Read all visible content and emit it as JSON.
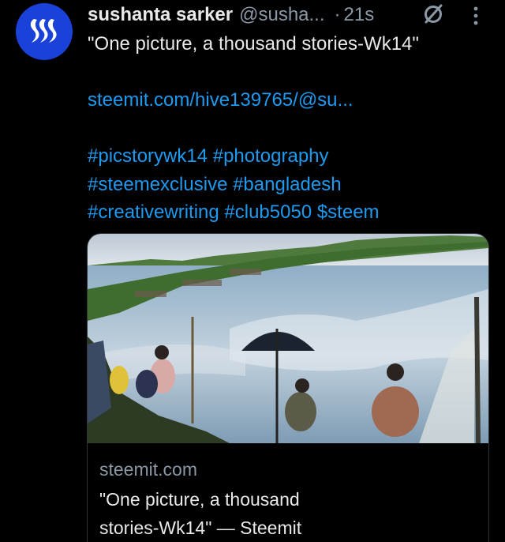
{
  "author": {
    "name": "sushanta sarker",
    "handle": "@susha...",
    "time_separator": "·",
    "time": "21s"
  },
  "icons": {
    "avatar": "steemit-logo-icon",
    "edit_status": "no-edit-icon",
    "menu": "more-vertical-icon"
  },
  "tweet": {
    "line1": "\"One picture, a thousand stories-Wk14\"",
    "link": "steemit.com/hive139765/@su...",
    "hashtags_line1": "#picstorywk14 #photography",
    "hashtags_line2": "#steemexclusive #bangladesh",
    "hashtags_line3": "#creativewriting #club5050 $steem"
  },
  "card": {
    "domain": "steemit.com",
    "title_line1": "\"One picture, a thousand",
    "title_line2": "stories-Wk14\" — Steemit"
  },
  "colors": {
    "background": "#000000",
    "link": "#1d9bf0",
    "secondary_text": "#8b98a5",
    "avatar_bg": "#1a41d8"
  }
}
